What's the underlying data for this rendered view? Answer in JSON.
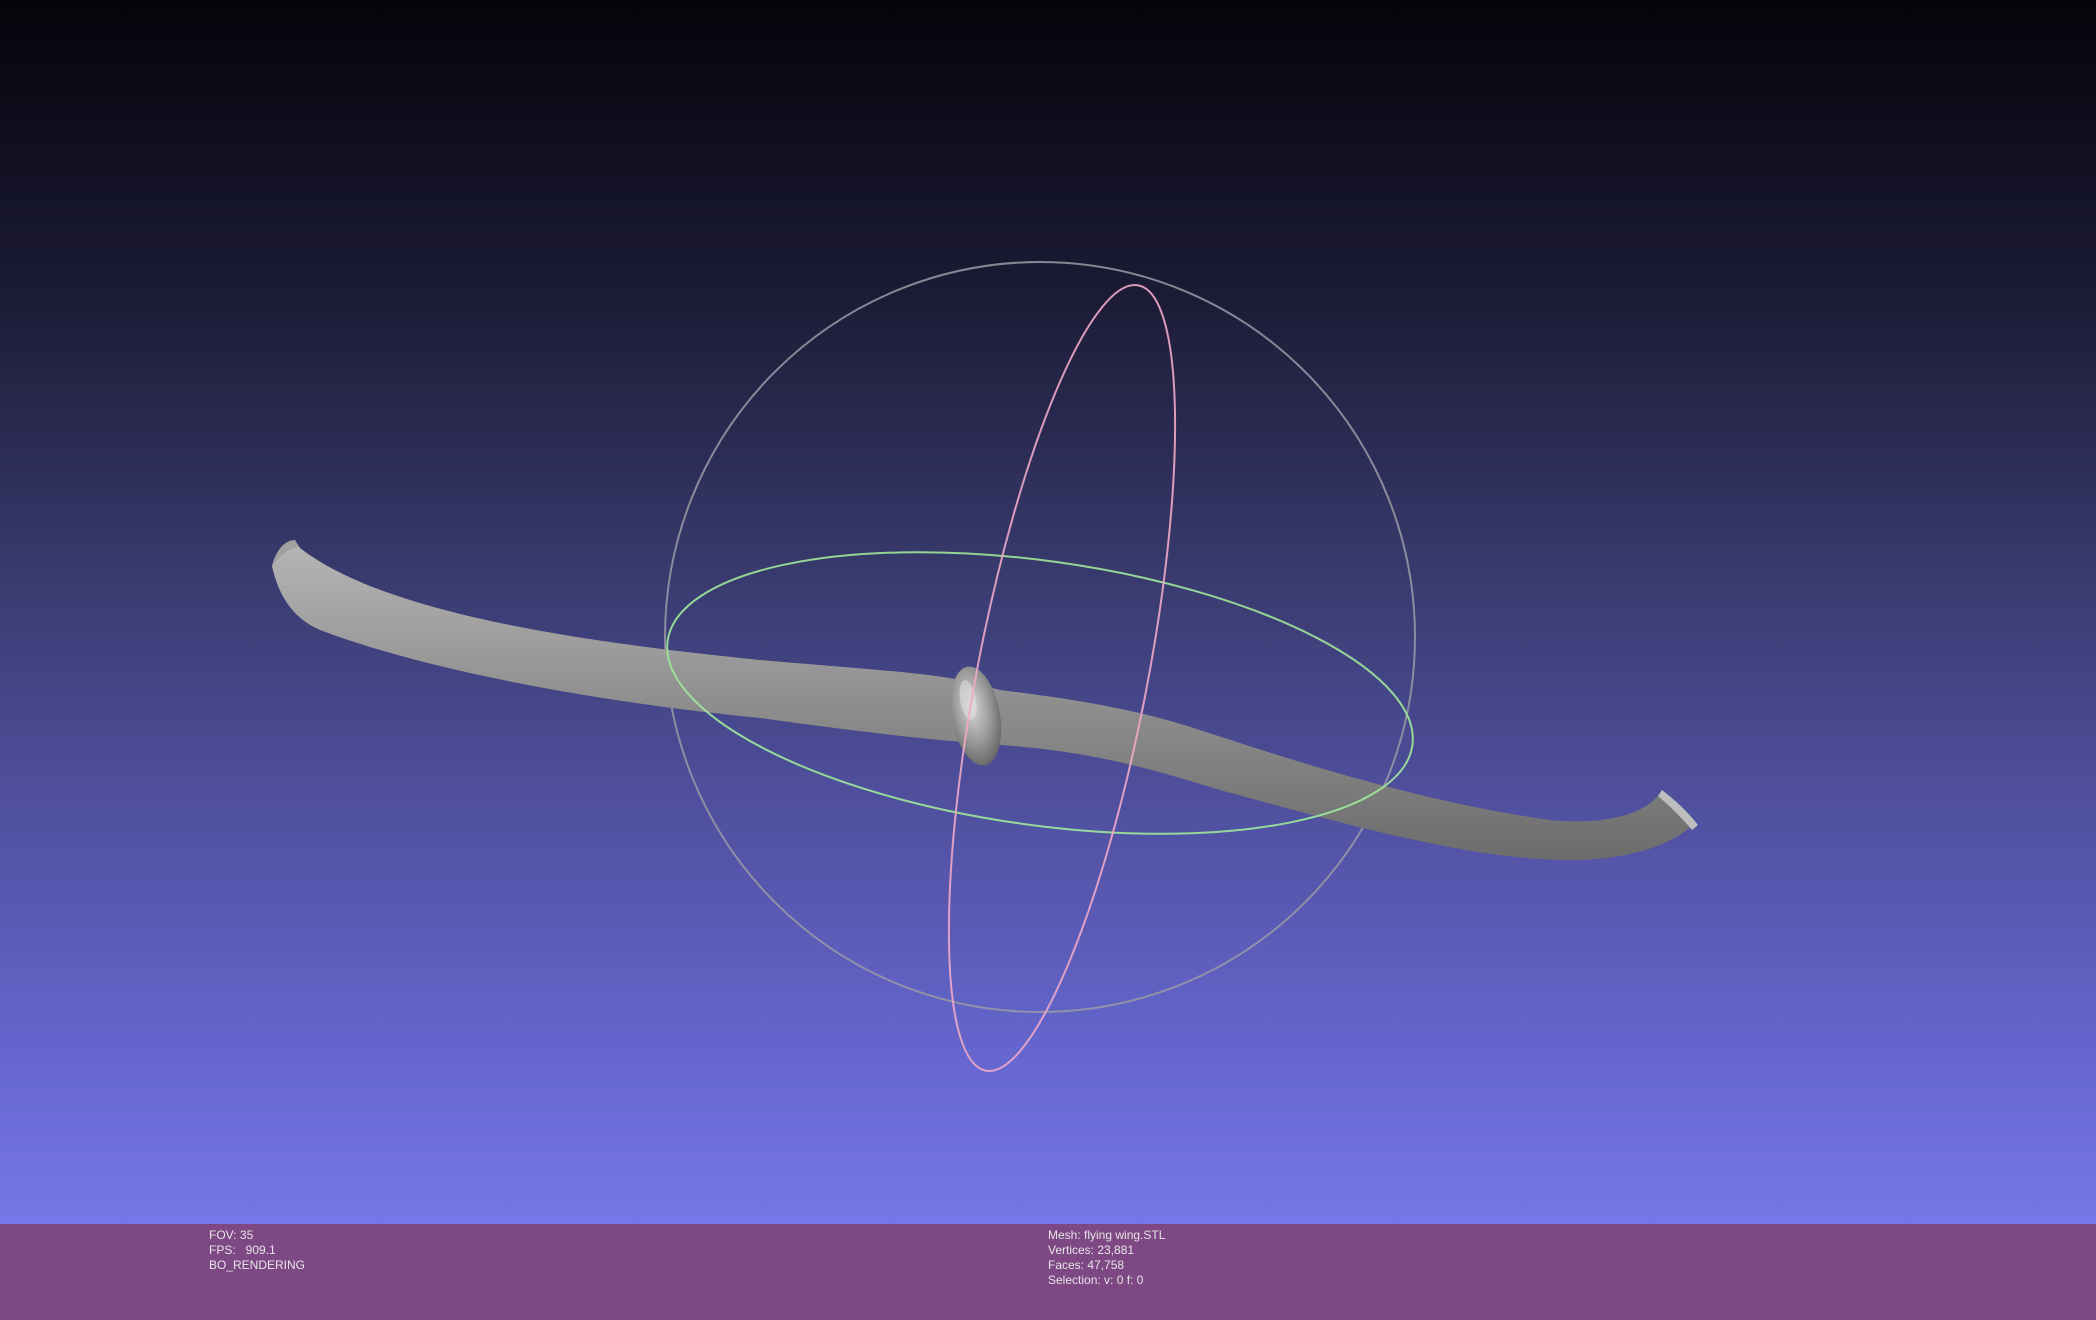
{
  "viewer": {
    "mesh_name": "flying wing.STL",
    "trackball": {
      "horizontal_ring_color": "#9ee89a",
      "vertical_ring_color": "#f0a8c8",
      "sphere_outline_color": "#9a9aa6"
    },
    "mesh_color": "#8c8c8c"
  },
  "status": {
    "fov": "FOV: 35",
    "fps": "FPS:   909.1",
    "mode": "BO_RENDERING",
    "mesh": "Mesh: flying wing.STL",
    "vertices": "Vertices: 23,881",
    "faces": "Faces: 47,758",
    "selection": "Selection: v: 0 f: 0"
  }
}
